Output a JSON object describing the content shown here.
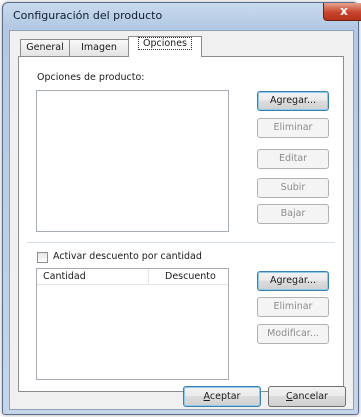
{
  "window": {
    "title": "Configuración del producto",
    "close_glyph": "x"
  },
  "tabs": [
    {
      "label": "General",
      "active": false
    },
    {
      "label": "Imagen",
      "active": false
    },
    {
      "label": "Opciones",
      "active": true
    }
  ],
  "options_section": {
    "label": "Opciones de producto:",
    "buttons": {
      "add": "Agregar...",
      "remove": "Eliminar",
      "edit": "Editar",
      "up": "Subir",
      "down": "Bajar"
    }
  },
  "discount_section": {
    "checkbox_label": "Activar descuento por cantidad",
    "checked": false,
    "columns": [
      "Cantidad",
      "Descuento"
    ],
    "buttons": {
      "add": "Agregar...",
      "remove": "Eliminar",
      "modify": "Modificar..."
    }
  },
  "footer": {
    "accept_first": "A",
    "accept_rest": "ceptar",
    "cancel_first": "C",
    "cancel_rest": "ancelar"
  }
}
